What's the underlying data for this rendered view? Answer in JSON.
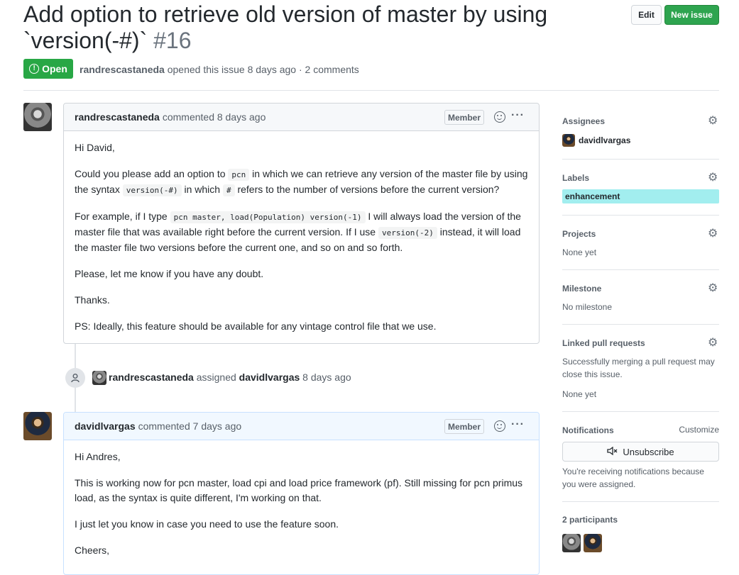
{
  "issue": {
    "title": "Add option to retrieve old version of master by using `version(-#)`",
    "number": "#16",
    "state": "Open",
    "author": "randrescastaneda",
    "meta_suffix": "opened this issue 8 days ago · 2 comments"
  },
  "header_buttons": {
    "edit": "Edit",
    "new_issue": "New issue"
  },
  "comments": [
    {
      "author": "randrescastaneda",
      "action": "commented 8 days ago",
      "badge": "Member",
      "body": {
        "greeting": "Hi David,",
        "p1_a": "Could you please add an option to",
        "p1_code1": "pcn",
        "p1_b": "in which we can retrieve any version of the master file by using the syntax",
        "p1_code2": "version(-#)",
        "p1_c": "in which",
        "p1_code3": "#",
        "p1_d": "refers to the number of versions before the current version?",
        "p2_a": "For example, if I type",
        "p2_code1": "pcn master, load(Population) version(-1)",
        "p2_b": "I will always load the version of the master file that was available right before the current version. If I use",
        "p2_code2": "version(-2)",
        "p2_c": "instead, it will load the master file two versions before the current one, and so on and so forth.",
        "p3": "Please, let me know if you have any doubt.",
        "p4": "Thanks.",
        "p5": "PS: Ideally, this feature should be available for any vintage control file that we use."
      }
    },
    {
      "author": "davidlvargas",
      "action": "commented 7 days ago",
      "badge": "Member",
      "body": {
        "greeting": "Hi Andres,",
        "p1": "This is working now for pcn master, load cpi and load price framework (pf). Still missing for pcn primus load, as the syntax is quite different, I'm working on that.",
        "p2": "I just let you know in case you need to use the feature soon.",
        "p3": "Cheers,"
      }
    }
  ],
  "event": {
    "actor": "randrescastaneda",
    "verb": "assigned",
    "target": "davidlvargas",
    "time": "8 days ago"
  },
  "sidebar": {
    "assignees": {
      "heading": "Assignees",
      "user": "davidlvargas"
    },
    "labels": {
      "heading": "Labels",
      "label": "enhancement",
      "label_color": "#a2eeef"
    },
    "projects": {
      "heading": "Projects",
      "value": "None yet"
    },
    "milestone": {
      "heading": "Milestone",
      "value": "No milestone"
    },
    "linked_prs": {
      "heading": "Linked pull requests",
      "description": "Successfully merging a pull request may close this issue.",
      "value": "None yet"
    },
    "notifications": {
      "heading": "Notifications",
      "customize": "Customize",
      "button": "Unsubscribe",
      "reason": "You're receiving notifications because you were assigned."
    },
    "participants": {
      "heading": "2 participants"
    }
  },
  "colors": {
    "open_green": "#28a745",
    "new_issue_green": "#2ea44f",
    "label_cyan": "#a2eeef"
  }
}
